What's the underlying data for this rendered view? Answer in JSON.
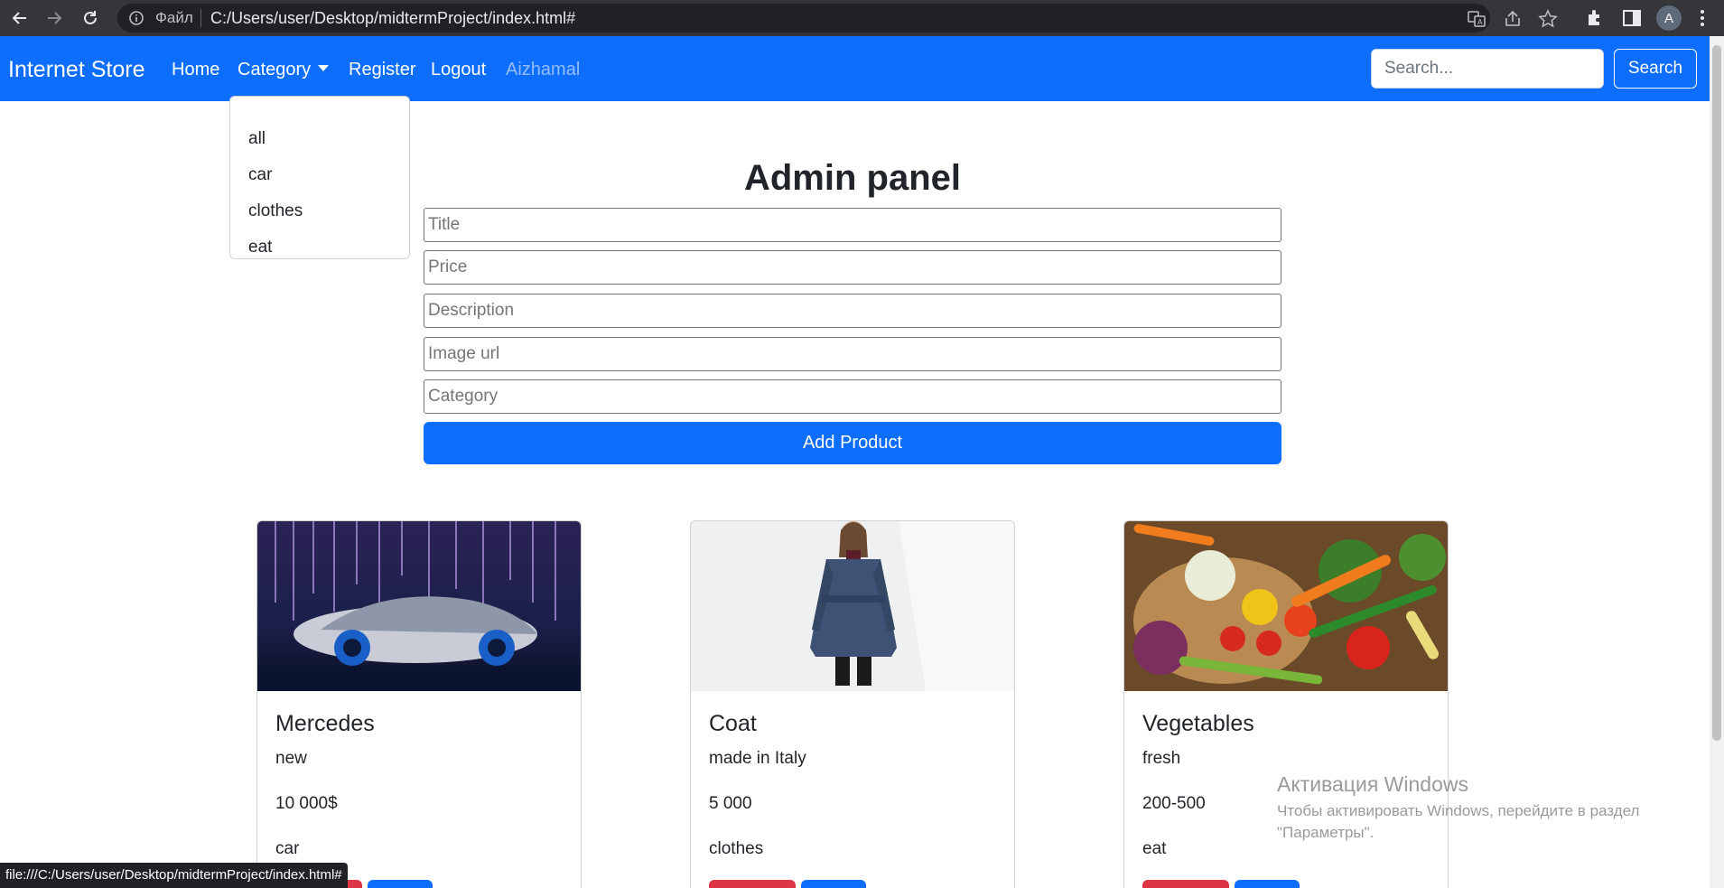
{
  "browser": {
    "scheme_label": "Файл",
    "url": "C:/Users/user/Desktop/midtermProject/index.html#",
    "profile_initial": "A",
    "status_url": "file:///C:/Users/user/Desktop/midtermProject/index.html#"
  },
  "navbar": {
    "brand": "Internet Store",
    "links": [
      "Home",
      "Category",
      "Register",
      "Logout",
      "Aizhamal"
    ],
    "search_placeholder": "Search...",
    "search_button": "Search"
  },
  "dropdown": {
    "items": [
      "all",
      "car",
      "clothes",
      "eat"
    ]
  },
  "admin": {
    "title": "Admin panel",
    "placeholders": {
      "title": "Title",
      "price": "Price",
      "description": "Description",
      "image_url": "Image url",
      "category": "Category"
    },
    "submit_label": "Add Product"
  },
  "products": [
    {
      "title": "Mercedes",
      "description": "new",
      "price": "10 000$",
      "category": "car"
    },
    {
      "title": "Coat",
      "description": "made in Italy",
      "price": "5 000",
      "category": "clothes"
    },
    {
      "title": "Vegetables",
      "description": "fresh",
      "price": "200-500",
      "category": "eat"
    }
  ],
  "watermark": {
    "title": "Активация Windows",
    "line1": "Чтобы активировать Windows, перейдите в раздел",
    "line2": "\"Параметры\"."
  }
}
